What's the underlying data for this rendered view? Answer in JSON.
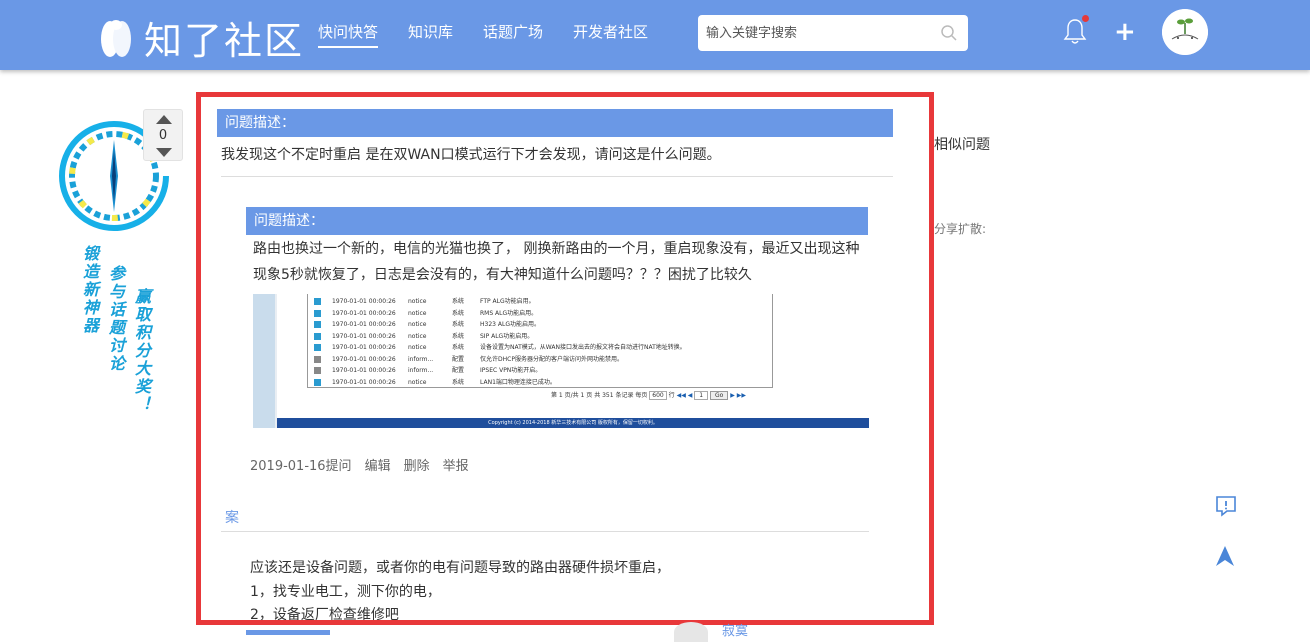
{
  "header": {
    "logo_text": "知了社区",
    "nav": [
      {
        "label": "快问快答",
        "active": true
      },
      {
        "label": "知识库",
        "active": false
      },
      {
        "label": "话题广场",
        "active": false
      },
      {
        "label": "开发者社区",
        "active": false
      }
    ],
    "search_placeholder": "输入关键字搜索",
    "has_notification": true
  },
  "vote": {
    "count": "0"
  },
  "slogan": {
    "col1": "锻造新神器",
    "col2": "参与话题讨论",
    "col3": "赢取积分大奖！"
  },
  "question": {
    "heading": "问题描述：",
    "text": "我发现这个不定时重启  是在双WAN口模式运行下才会发现，请问这是什么问题。"
  },
  "quoted": {
    "heading": "问题描述：",
    "line1": "路由也换过一个新的，电信的光猫也换了，   刚换新路由的一个月，重启现象没有，最近又出现这种",
    "line2": "现象5秒就恢复了，日志是会没有的，有大神知道什么问题吗？？？困扰了比较久"
  },
  "log_table": {
    "rows": [
      {
        "time": "1970-01-01 00:00:26",
        "level": "notice",
        "type": "系统",
        "msg": "FTP ALG功能启用。"
      },
      {
        "time": "1970-01-01 00:00:26",
        "level": "notice",
        "type": "系统",
        "msg": "RMS ALG功能启用。"
      },
      {
        "time": "1970-01-01 00:00:26",
        "level": "notice",
        "type": "系统",
        "msg": "H323 ALG功能启用。"
      },
      {
        "time": "1970-01-01 00:00:26",
        "level": "notice",
        "type": "系统",
        "msg": "SIP ALG功能启用。"
      },
      {
        "time": "1970-01-01 00:00:26",
        "level": "notice",
        "type": "系统",
        "msg": "设备设置为NAT模式，从WAN接口发出去的报文将会自动进行NAT地址转换。"
      },
      {
        "time": "1970-01-01 00:00:26",
        "level": "inform...",
        "type": "配置",
        "msg": "仅允许DHCP服务器分配的客户端访问外网功能禁用。"
      },
      {
        "time": "1970-01-01 00:00:26",
        "level": "inform...",
        "type": "配置",
        "msg": "IPSEC VPN功能开启。"
      },
      {
        "time": "1970-01-01 00:00:26",
        "level": "notice",
        "type": "系统",
        "msg": "LAN1端口物理连接已成功。"
      }
    ],
    "pager": "第 1 页/共 1 页 共 351 条记录 每页",
    "per_page": "600",
    "page_label": "行",
    "page_input": "1",
    "go_label": "Go",
    "footer": "Copyright (c) 2014-2018 新华三技术有限公司 版权所有，保留一切权利。"
  },
  "meta": {
    "date": "2019-01-16提问",
    "edit": "编辑",
    "delete": "删除",
    "report": "举报"
  },
  "answer": {
    "title": "案",
    "lines": [
      "应该还是设备问题，或者你的电有问题导致的路由器硬件损坏重启，",
      "1，找专业电工，测下你的电，",
      "2，设备返厂检查维修吧"
    ],
    "author": "寂寞"
  },
  "sidebar": {
    "similar_label": "相似问题",
    "share_label": "分享扩散:"
  },
  "colors": {
    "brand": "#6a98e6",
    "highlight_border": "#e8383a",
    "slogan": "#1aa1d8",
    "notification_dot": "#e53a3a"
  }
}
